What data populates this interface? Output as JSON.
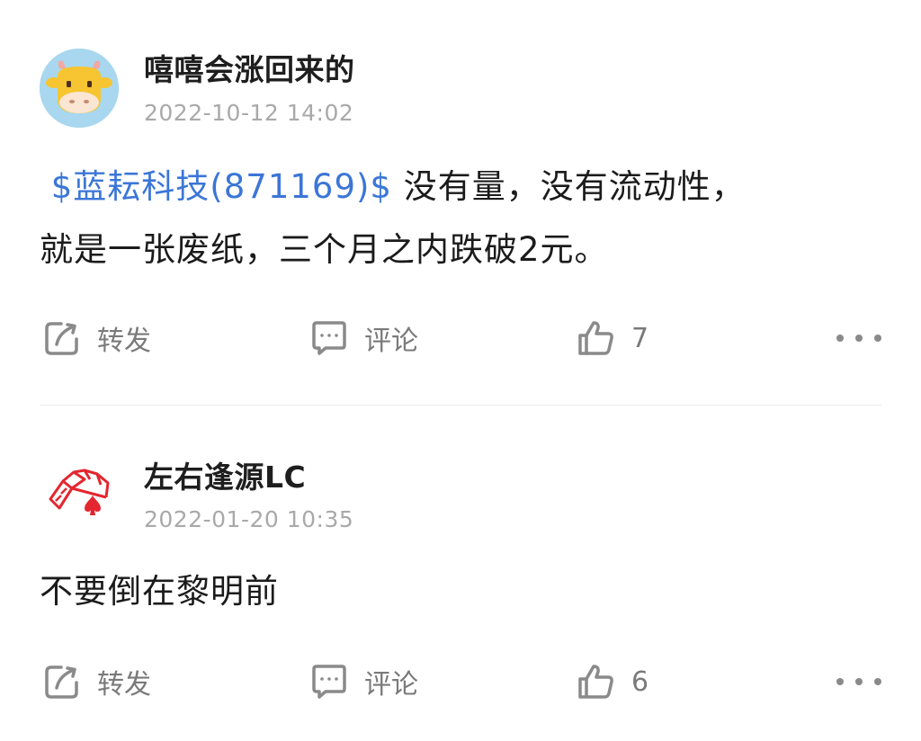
{
  "posts": [
    {
      "username": "嘻嘻会涨回来的",
      "timestamp": "2022-10-12 14:02",
      "stock_link": "$蓝耘科技(871169)$",
      "text_line1": " 没有量，没有流动性，",
      "text_line2": "就是一张废纸，三个月之内跌破2元。",
      "avatar_icon": "cow-avatar-icon",
      "actions": {
        "repost_label": "转发",
        "comment_label": "评论",
        "like_count": "7"
      }
    },
    {
      "username": "左右逢源LC",
      "timestamp": "2022-01-20 10:35",
      "text": "不要倒在黎明前",
      "avatar_icon": "playing-cards-avatar-icon",
      "actions": {
        "repost_label": "转发",
        "comment_label": "评论",
        "like_count": "6"
      }
    }
  ],
  "colors": {
    "link": "#3b76d7",
    "timestamp": "#a9a9a9",
    "action_label": "#7a7a7a",
    "card_red": "#e3262f"
  },
  "icons": {
    "repost": "repost-icon",
    "comment": "comment-icon",
    "like": "thumbs-up-icon",
    "more": "more-icon"
  }
}
